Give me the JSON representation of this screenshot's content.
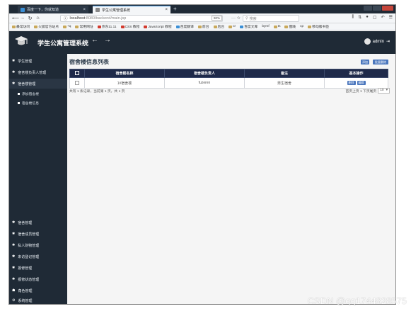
{
  "browser": {
    "tabs": [
      {
        "label": "百度一下，你就知道",
        "close": "×"
      },
      {
        "label": "学生公寓管理系统",
        "close": "×"
      }
    ],
    "new_tab": "+",
    "url_protocol": "ⓘ",
    "url_host": "localhost",
    "url_rest": ":8080/backend/main.jsp",
    "zoom": "90%",
    "more": "··· ☆",
    "search_placeholder": "搜索",
    "bookmarks": [
      "最常访问",
      "火狐官方站点",
      "+q",
      "常用网址",
      "京东11.11",
      "CSS 教程",
      "JavaScript 教程",
      "百度翻译",
      "前台",
      "后台",
      "cr",
      "百度文库",
      "bymf",
      "ts",
      "图践",
      "cp",
      "移动版书签"
    ]
  },
  "app": {
    "title": "学生公寓管理系统",
    "back": "←",
    "forward": "→",
    "user": "admin"
  },
  "sidebar": {
    "top_items": [
      {
        "label": "学生管理"
      },
      {
        "label": "宿舍楼负责人管理"
      },
      {
        "label": "宿舍楼管理"
      }
    ],
    "sub_items": [
      {
        "label": "添加宿舍楼"
      },
      {
        "label": "宿舍楼信息"
      }
    ],
    "bottom_items": [
      {
        "label": "宿舍管理"
      },
      {
        "label": "宿舍成员管理"
      },
      {
        "label": "私人财物管理"
      },
      {
        "label": "来访登记管理"
      },
      {
        "label": "报修管理"
      },
      {
        "label": "报修状态管理"
      },
      {
        "label": "角色管理"
      },
      {
        "label": "系统管理"
      }
    ]
  },
  "content": {
    "title": "宿舍楼信息列表",
    "add_button": "添加",
    "bulk_delete_button": "批量删除",
    "columns": [
      "宿舍楼名称",
      "宿舍楼负责人",
      "备注",
      "基本操作"
    ],
    "rows": [
      {
        "name": "1#宿舍楼",
        "manager": "fuzeren",
        "note": "男生宿舍",
        "delete": "删除",
        "edit": "编辑"
      }
    ],
    "summary": "共有 1 条记录，当前第 1 页，共 1 页",
    "pager": "首页上页 1 下页尾页",
    "page_size": "10",
    "page_size_arrow": "▾"
  },
  "watermark": "CSDN @qq1744828575"
}
